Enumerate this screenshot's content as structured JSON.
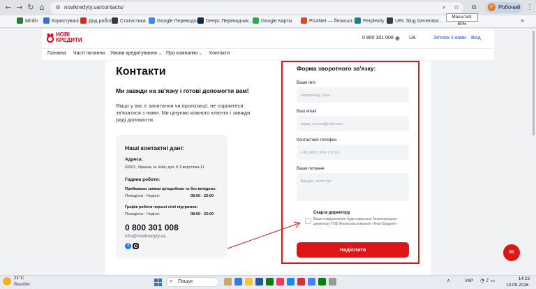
{
  "browser": {
    "url": "novikredyty.ua/contacts/",
    "zoom_tooltip": "Масштаб: 80%",
    "profile_label": "Робочий",
    "profile_initial": "Р",
    "bookmarks": [
      "Minfin",
      "Користувачі",
      "Дод.робота",
      "Статистика",
      "Google Переводчик",
      "DeepL Переводчик...",
      "Google Карты",
      "Pic4Net — безкошт...",
      "Perplexity",
      "URL Slug Generator..."
    ],
    "bookmark_colors": [
      "#2b7a3d",
      "#3b6fd6",
      "#d22",
      "#3a3a3a",
      "#4285f4",
      "#0f2b46",
      "#34a853",
      "#e04a1b",
      "#20808d",
      "#3a3a3a"
    ]
  },
  "site": {
    "logo_text": "НОВІ КРЕДИТИ",
    "phone": "0 800 301 008",
    "lang": "UA",
    "header_contact": "Зв'язок з нами",
    "header_login": "Вхід",
    "nav": [
      "Головна",
      "Часті питання",
      "Умови кредитування",
      "Про компанію",
      "Контакти"
    ],
    "accent_color": "#e01616"
  },
  "contacts": {
    "heading": "Контакти",
    "subheading": "Ми завжди на зв'язку і готові допомогти вам!",
    "intro": "Якщо у вас є запитання чи пропозиції, не соромтеся зв'язатися з нами. Ми цінуємо кожного клієнта і завжди раді допомогти.",
    "card_title": "Наші контактні дані:",
    "address_label": "Адреса:",
    "address_value": "02002, Україна, м. Київ, вул. Є.Сверстюка,11",
    "hours_label": "Години роботи:",
    "schedule1_title": "Приймаємо заявки цілодобово та без вихідних:",
    "schedule1_days": "Понеділок - Неділя:",
    "schedule1_time": "08:00 - 23:00",
    "schedule2_title": "Графік роботи першої лінії підтримки:",
    "schedule2_days": "Понеділок - Неділя:",
    "schedule2_time": "08:00 - 23:00",
    "phone": "0 800 301 008",
    "email": "info@novikredyty.ua"
  },
  "form": {
    "title": "Форма зворотного зв'язку:",
    "name_label": "Ваше ім'я",
    "name_placeholder": "Наприклад, Іван",
    "email_label": "Ваш email",
    "email_placeholder": "ваша_пошта@mail.com",
    "phone_label": "Контактний телефон",
    "phone_placeholder": "+38 (0XX) XXX XX XX",
    "question_label": "Ваше питання",
    "question_placeholder": "Введіть текст тут",
    "director_title": "Скарга директору",
    "director_desc": "Ваше повідомлення буде надіслано безпосередньо директору ТОВ Фінансова компанія «Нові Кредити»",
    "submit": "Надіслати"
  },
  "taskbar": {
    "temperature": "21°C",
    "weather": "Bewölkt",
    "search": "Пошук",
    "lang": "УКР",
    "time": "14:23",
    "date": "10.09.2026",
    "app_colors": [
      "#c9a86a",
      "#3a7bd5",
      "#f5c542",
      "#2b5797",
      "#0f7b0f",
      "#e4405f",
      "#1e88e5",
      "#d13438",
      "#4285f4",
      "#107c10",
      "#999999"
    ]
  }
}
